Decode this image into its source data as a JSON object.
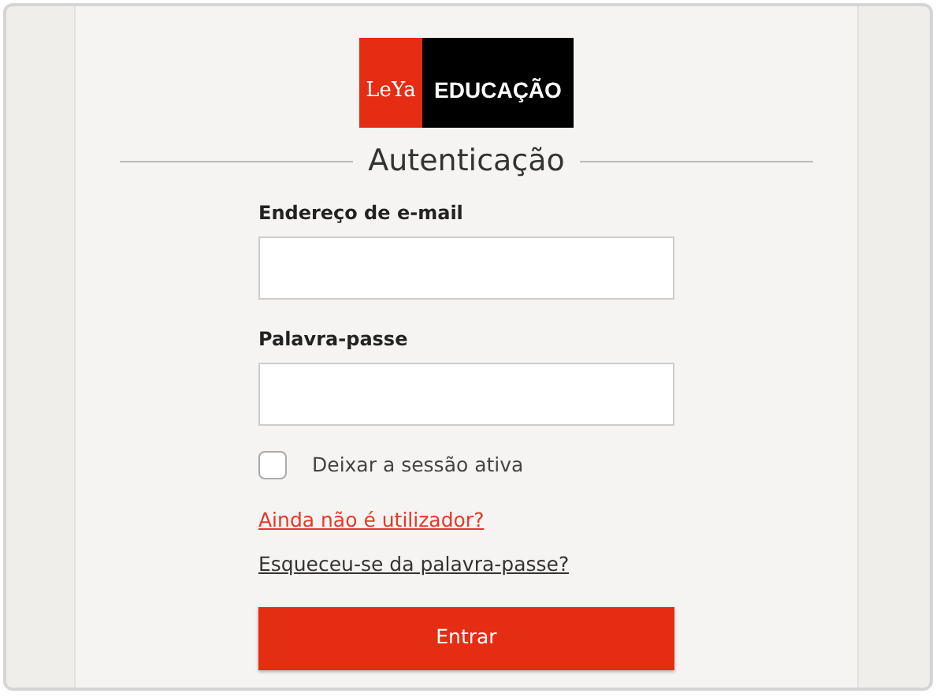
{
  "logo": {
    "mark": "LeYa",
    "text": "EDUCAÇÃO"
  },
  "title": "Autenticação",
  "fields": [
    {
      "label": "Endereço de e-mail"
    },
    {
      "label": "Palavra-passe"
    }
  ],
  "remember": {
    "label": "Deixar a sessão ativa",
    "checked": false
  },
  "links": [
    {
      "text": "Ainda não é utilizador?",
      "kind": "accent"
    },
    {
      "text": "Esqueceu-se da palavra-passe?",
      "kind": "plain"
    }
  ],
  "submit": "Entrar"
}
